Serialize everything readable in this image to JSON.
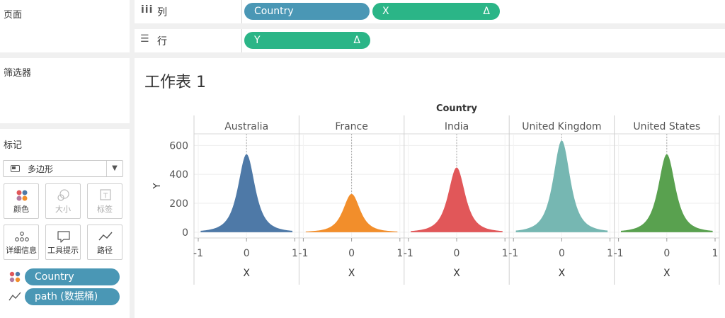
{
  "pages_card": {
    "title": "页面"
  },
  "filters_card": {
    "title": "筛选器"
  },
  "marks_card": {
    "title": "标记",
    "mark_type": "多边形",
    "buttons": [
      {
        "label": "颜色",
        "icon": "color-dots-icon",
        "enabled": true
      },
      {
        "label": "大小",
        "icon": "size-circles-icon",
        "enabled": false
      },
      {
        "label": "标签",
        "icon": "label-t-icon",
        "enabled": false
      },
      {
        "label": "详细信息",
        "icon": "detail-dots-icon",
        "enabled": true
      },
      {
        "label": "工具提示",
        "icon": "tooltip-bubble-icon",
        "enabled": true
      },
      {
        "label": "路径",
        "icon": "path-line-icon",
        "enabled": true
      }
    ],
    "fields": [
      {
        "label": "Country",
        "icon": "color-dots-icon"
      },
      {
        "label": "path (数据桶)",
        "icon": "path-line-icon"
      }
    ]
  },
  "columns_shelf": {
    "label": "列",
    "icon": "columns-icon",
    "pills": [
      {
        "label": "Country",
        "type": "dimension",
        "delta": ""
      },
      {
        "label": "X",
        "type": "measure",
        "delta": "Δ"
      }
    ]
  },
  "rows_shelf": {
    "label": "行",
    "icon": "rows-icon",
    "pills": [
      {
        "label": "Y",
        "type": "measure",
        "delta": "Δ"
      }
    ]
  },
  "sheet": {
    "title": "工作表 1"
  },
  "colors": {
    "dimension_pill": "#4a97b5",
    "measure_pill": "#2bb587"
  },
  "chart_data": {
    "type": "area",
    "title": "Country",
    "xlabel": "X",
    "ylabel": "Y",
    "ylim": [
      -40,
      680
    ],
    "yticks": [
      0,
      200,
      400,
      600
    ],
    "xlim": [
      -1,
      1
    ],
    "xticks": [
      "-1",
      "0",
      "1"
    ],
    "grid": true,
    "series": [
      {
        "name": "Australia",
        "peak": 540,
        "color": "#4e79a7"
      },
      {
        "name": "France",
        "peak": 265,
        "color": "#f28e2b"
      },
      {
        "name": "India",
        "peak": 448,
        "color": "#e15759"
      },
      {
        "name": "United Kingdom",
        "peak": 635,
        "color": "#76b7b2"
      },
      {
        "name": "United States",
        "peak": 540,
        "color": "#59a14f"
      }
    ]
  }
}
